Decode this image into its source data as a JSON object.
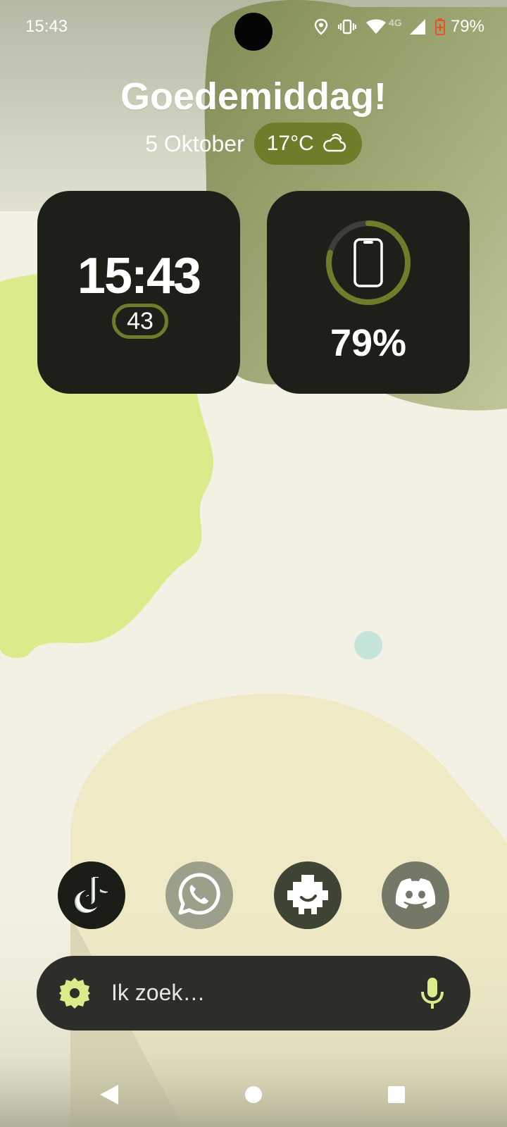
{
  "status_bar": {
    "time": "15:43",
    "network_label": "4G",
    "battery_text": "79%",
    "icons": [
      "location-icon",
      "vibrate-icon",
      "wifi-icon",
      "signal-icon",
      "battery-icon"
    ]
  },
  "header": {
    "greeting": "Goedemiddag!",
    "date": "5 Oktober",
    "temperature": "17°C",
    "weather_icon": "partly-cloudy-icon"
  },
  "clock_widget": {
    "time": "15:43",
    "seconds": "43"
  },
  "battery_widget": {
    "percent_text": "79%",
    "level": 0.79,
    "icon": "phone-icon"
  },
  "dock": {
    "apps": [
      {
        "name": "TikTok",
        "icon": "tiktok-icon"
      },
      {
        "name": "WhatsApp",
        "icon": "whatsapp-icon"
      },
      {
        "name": "Puzzle",
        "icon": "puzzle-icon"
      },
      {
        "name": "Discord",
        "icon": "discord-icon"
      }
    ]
  },
  "search": {
    "placeholder": "Ik zoek…",
    "left_icon": "settings-gear-icon",
    "right_icon": "microphone-icon"
  },
  "navigation": {
    "buttons": [
      "back-icon",
      "home-icon",
      "recents-icon"
    ]
  },
  "colors": {
    "accent": "#6f7d2b",
    "widget_bg": "#1d1f19",
    "search_bg": "#2d2d2a",
    "lime": "#dbea8a",
    "teal": "#c5e5da"
  }
}
